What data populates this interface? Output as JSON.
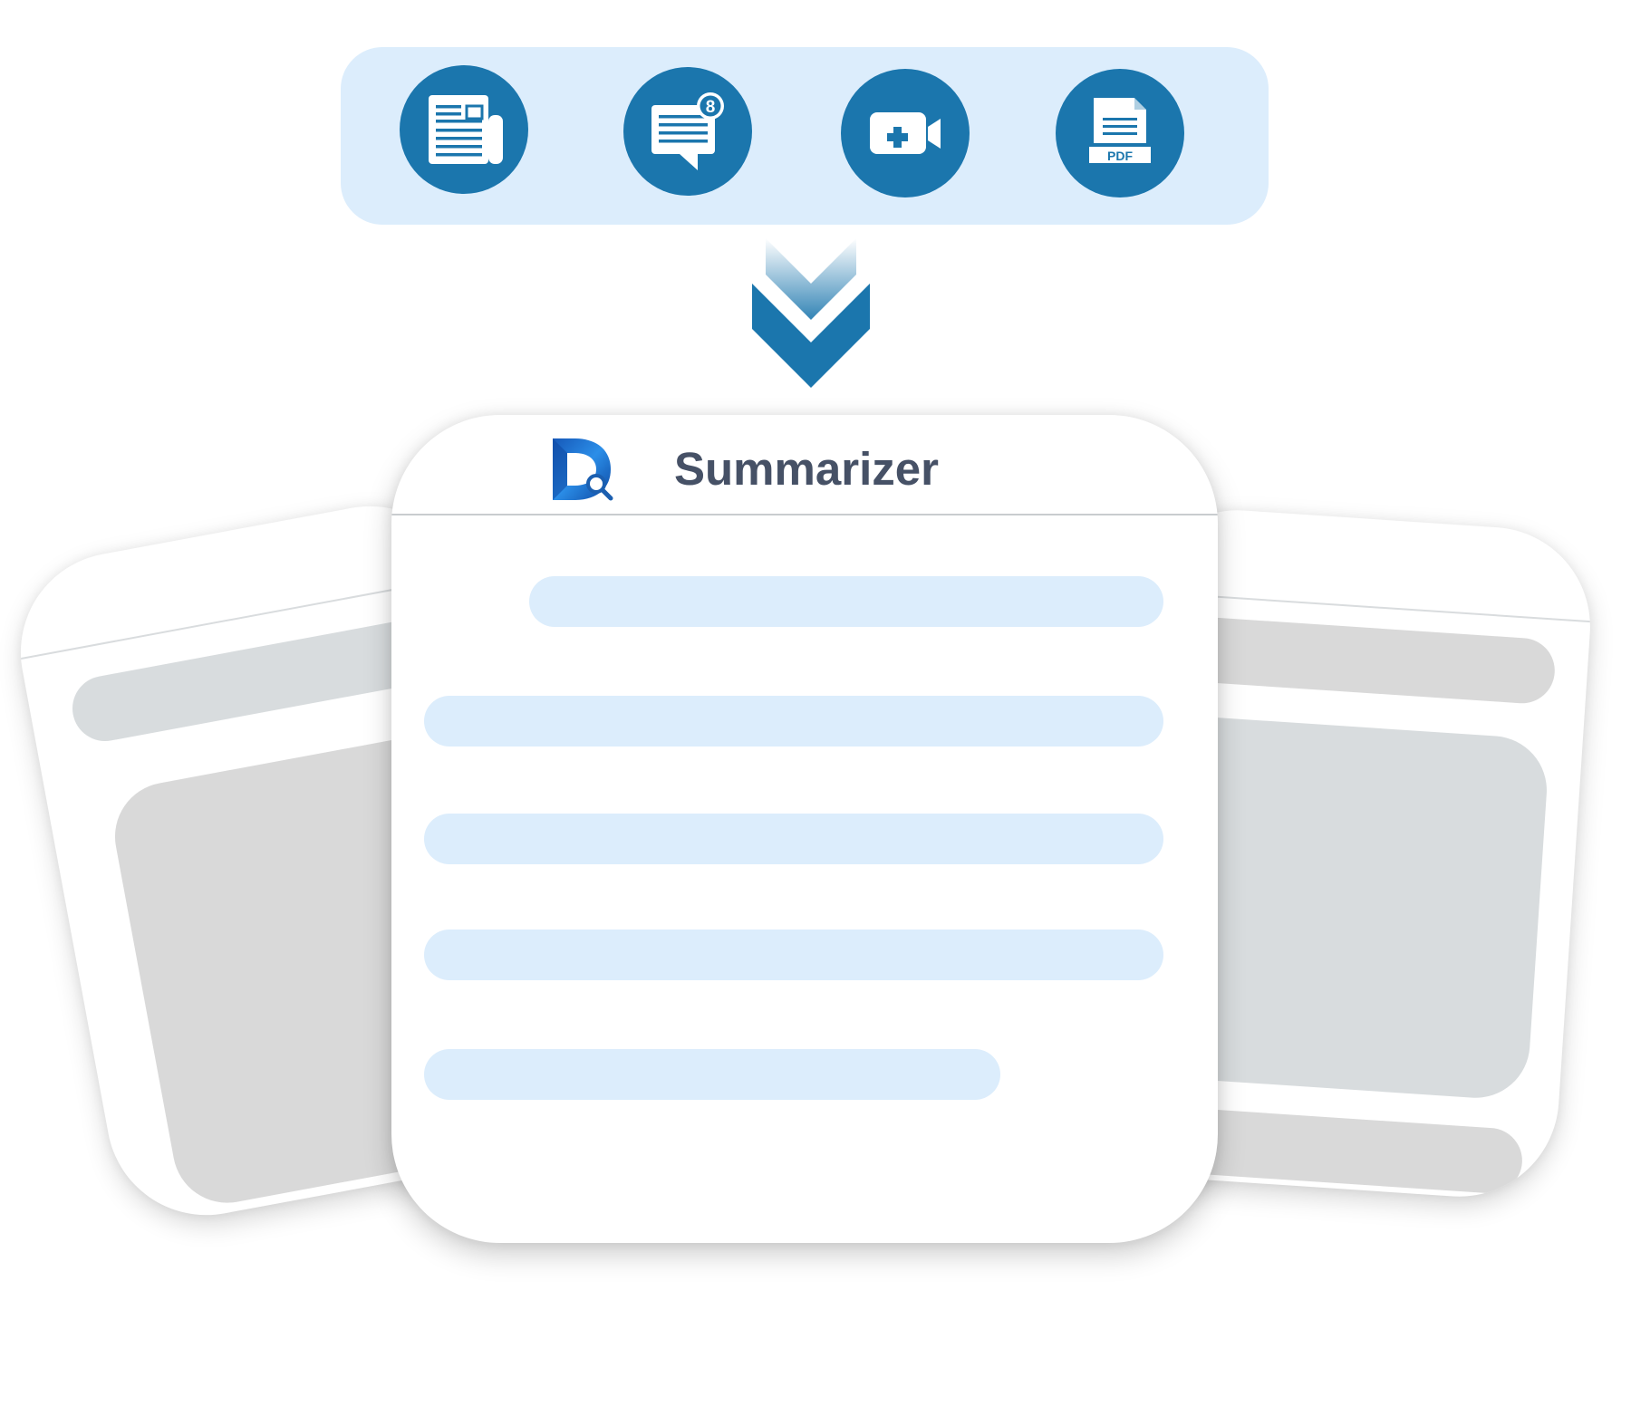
{
  "colors": {
    "accent": "#1b76ad",
    "input_bar_bg": "#dcedfc",
    "summary_line": "#dcedfc",
    "back_card_block": "#d8dcde",
    "back_card_block_alt": "#d9d9d9",
    "title_text": "#465166",
    "white": "#ffffff"
  },
  "sources": [
    {
      "icon": "newspaper-icon"
    },
    {
      "icon": "chat-message-icon",
      "badge": "8"
    },
    {
      "icon": "video-call-icon"
    },
    {
      "icon": "pdf-document-icon",
      "label": "PDF"
    }
  ],
  "flow_icon": "double-chevron-down-icon",
  "summarizer": {
    "logo_icon": "d-search-logo-icon",
    "title": "Summarizer"
  }
}
